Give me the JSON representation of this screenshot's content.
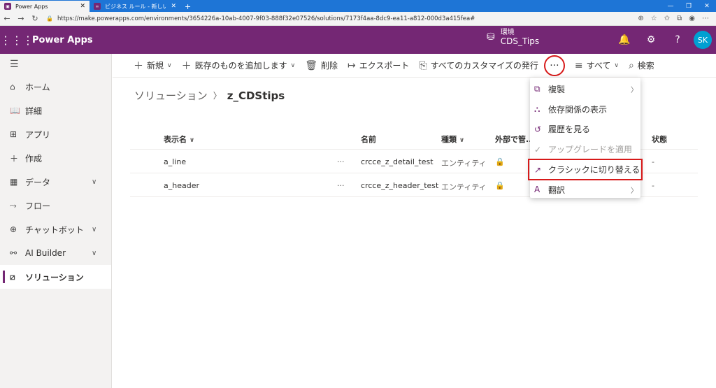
{
  "browser": {
    "tabs": [
      {
        "label": "Power Apps",
        "close": "✕",
        "icon": "power-apps-icon"
      },
      {
        "label": "ビジネス ルール - 新しいルール - Micr",
        "close": "✕",
        "icon": "dynamics-icon"
      }
    ],
    "new_tab": "+",
    "url": "https://make.powerapps.com/environments/3654226a-10ab-4007-9f03-888f32e07526/solutions/7173f4aa-8dc9-ea11-a812-000d3a415fea#"
  },
  "header": {
    "app_name": "Power Apps",
    "env_label": "環境",
    "env_name": "CDS_Tips",
    "avatar": "SK"
  },
  "sidebar": {
    "items": [
      {
        "label": "ホーム",
        "icon": "home-icon",
        "chevron": false
      },
      {
        "label": "詳細",
        "icon": "book-icon",
        "chevron": false
      },
      {
        "label": "アプリ",
        "icon": "apps-icon",
        "chevron": false
      },
      {
        "label": "作成",
        "icon": "plus-icon",
        "chevron": false
      },
      {
        "label": "データ",
        "icon": "table-icon",
        "chevron": true
      },
      {
        "label": "フロー",
        "icon": "flow-icon",
        "chevron": false
      },
      {
        "label": "チャットボット",
        "icon": "bot-icon",
        "chevron": true
      },
      {
        "label": "AI Builder",
        "icon": "ai-icon",
        "chevron": true
      },
      {
        "label": "ソリューション",
        "icon": "solution-icon",
        "chevron": false,
        "selected": true
      }
    ]
  },
  "commands": {
    "new": "新規",
    "add_existing": "既存のものを追加します",
    "delete": "削除",
    "export": "エクスポート",
    "publish_all": "すべてのカスタマイズの発行",
    "more": "···",
    "view_all": "すべて",
    "search": "検索"
  },
  "breadcrumb": {
    "parent": "ソリューション",
    "current": "z_CDStips"
  },
  "grid": {
    "columns": {
      "display_name": "表示名",
      "name": "名前",
      "type": "種類",
      "managed": "外部で管...",
      "status": "状態"
    },
    "rows": [
      {
        "display_name": "a_line",
        "more": "···",
        "name": "crcce_z_detail_test",
        "type": "エンティティ",
        "status": "-"
      },
      {
        "display_name": "a_header",
        "more": "···",
        "name": "crcce_z_header_test",
        "type": "エンティティ",
        "status": "-"
      }
    ]
  },
  "menu": {
    "items": [
      {
        "label": "複製",
        "icon": "copy-icon",
        "submenu": true
      },
      {
        "label": "依存関係の表示",
        "icon": "hierarchy-icon",
        "submenu": false
      },
      {
        "label": "履歴を見る",
        "icon": "history-icon",
        "submenu": false
      },
      {
        "label": "アップグレードを適用",
        "icon": "check-icon",
        "submenu": false,
        "disabled": true
      },
      {
        "label": "クラシックに切り替える",
        "icon": "open-external-icon",
        "submenu": false,
        "highlighted": true
      },
      {
        "label": "翻訳",
        "icon": "translate-icon",
        "submenu": true
      }
    ]
  }
}
